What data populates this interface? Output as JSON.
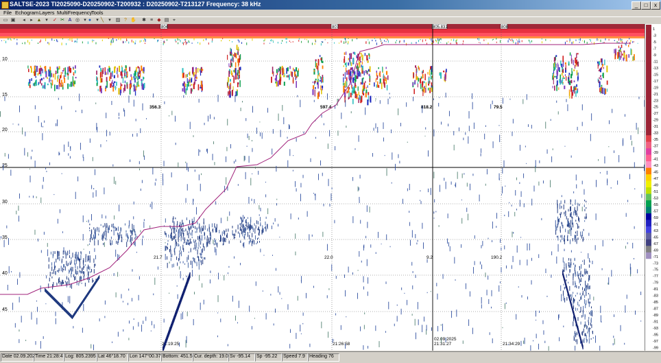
{
  "window": {
    "title": "SALTSE-2023  TI2025090-D20250902-T200932 : D20250902-T213127  Frequency: 38 kHz",
    "controls": {
      "minimize": "_",
      "maximize": "□",
      "close": "x"
    }
  },
  "menu": [
    "File",
    "Echogram",
    "Layers",
    "MultiFrequency",
    "Tools"
  ],
  "toolbar": {
    "icons": [
      "open-icon",
      "save-icon",
      "back-icon",
      "forward-icon",
      "pin-icon",
      "dropdown-icon",
      "check-icon",
      "scissors-icon",
      "text-icon",
      "zoom-icon",
      "dropdown-icon",
      "globe-icon",
      "dropdown-icon",
      "pen-icon",
      "dropdown-icon",
      "photo-icon",
      "help-icon",
      "hand-icon",
      "settings-icon",
      "layers-icon",
      "eraser-icon",
      "list-icon",
      "select-icon"
    ]
  },
  "echogram": {
    "depth_labels": [
      "10",
      "15",
      "20",
      "25",
      "30",
      "35",
      "40",
      "45"
    ],
    "top_markers": [
      "804",
      "807",
      "805.831",
      "808"
    ],
    "distance_labels": [
      "356.3",
      "597.4",
      "818.2",
      "79.5"
    ],
    "value_labels": [
      "21.7",
      "22.0",
      "9.2",
      "190.2"
    ],
    "time_labels": [
      "21:19:25",
      "21:26:58",
      "02.09.2025\n21:31:27",
      "21:34:29"
    ],
    "colors": {
      "bottom_line": "#a0207a",
      "surface": "#d02030",
      "cursor_line": "#000000"
    }
  },
  "scale": {
    "labels": [
      "1",
      "3",
      "5",
      "7",
      "9",
      "11",
      "13",
      "15",
      "17",
      "19",
      "21",
      "23",
      "25",
      "27",
      "29",
      "31",
      "33",
      "35",
      "37",
      "39",
      "41",
      "43",
      "45",
      "47",
      "49",
      "51",
      "53",
      "55",
      "57",
      "59",
      "61",
      "63",
      "65",
      "67",
      "69",
      "71",
      "73",
      "75",
      "77",
      "79",
      "81",
      "83",
      "85",
      "87",
      "89",
      "91",
      "93",
      "95",
      "97",
      "99"
    ],
    "colors": [
      "#9b2335",
      "#9b2335",
      "#9b2335",
      "#9b2335",
      "#9b2335",
      "#9b2335",
      "#9b2335",
      "#9b2335",
      "#9b2335",
      "#9b2335",
      "#9b2335",
      "#9b2335",
      "#9b2335",
      "#9b2335",
      "#9b2335",
      "#9b2335",
      "#9b2335",
      "#e0404a",
      "#f06080",
      "#e040a0",
      "#ff6090",
      "#ff90c0",
      "#ff8000",
      "#ffd000",
      "#f0f000",
      "#c0e000",
      "#60c060",
      "#00a050",
      "#008070",
      "#0000a0",
      "#2020c0",
      "#4040e0",
      "#6060a0",
      "#404080",
      "#808080",
      "#a090c0",
      "#ffffff",
      "#ffffff",
      "#ffffff",
      "#ffffff",
      "#ffffff",
      "#ffffff",
      "#ffffff",
      "#ffffff",
      "#ffffff",
      "#ffffff",
      "#ffffff",
      "#ffffff",
      "#ffffff",
      "#ffffff"
    ]
  },
  "status": {
    "date": "Date 02.09.202",
    "time": "Time 21:28:4",
    "log": "Log: 805.2395",
    "lat": "Lat 46°18.70",
    "lon": "Lon 147°00.37",
    "bottom": "Bottom: 451.5",
    "cur_depth": "Cur. depth: 19.0",
    "sv": "Sv -95.14",
    "sp": "Sp -95.22",
    "speed": "Speed 7.9",
    "heading": "Heading 76"
  }
}
